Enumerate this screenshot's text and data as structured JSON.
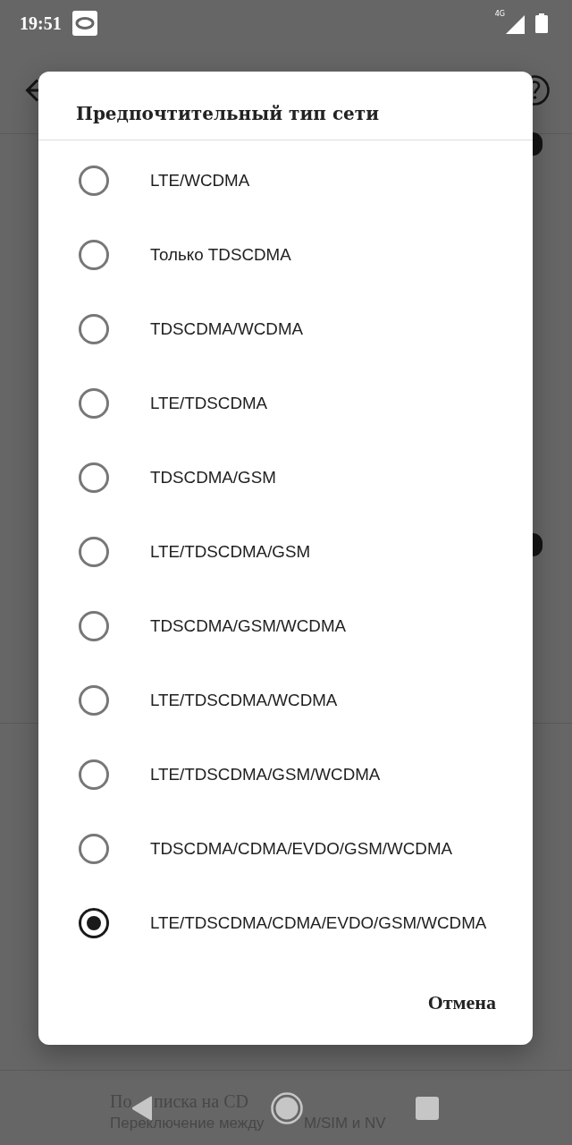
{
  "status_bar": {
    "time": "19:51",
    "network_type": "4G"
  },
  "background_list": [
    {
      "title_parts": [
        "По",
        "писка на CD"
      ],
      "subtitle_parts": [
        "Переключение между",
        "M/SIM и NV"
      ]
    }
  ],
  "dialog": {
    "title": "Предпочтительный тип сети",
    "options": [
      {
        "label": "LTE/WCDMA",
        "selected": false
      },
      {
        "label": "Только TDSCDMA",
        "selected": false
      },
      {
        "label": "TDSCDMA/WCDMA",
        "selected": false
      },
      {
        "label": "LTE/TDSCDMA",
        "selected": false
      },
      {
        "label": "TDSCDMA/GSM",
        "selected": false
      },
      {
        "label": "LTE/TDSCDMA/GSM",
        "selected": false
      },
      {
        "label": "TDSCDMA/GSM/WCDMA",
        "selected": false
      },
      {
        "label": "LTE/TDSCDMA/WCDMA",
        "selected": false
      },
      {
        "label": "LTE/TDSCDMA/GSM/WCDMA",
        "selected": false
      },
      {
        "label": "TDSCDMA/CDMA/EVDO/GSM/WCDMA",
        "selected": false
      },
      {
        "label": "LTE/TDSCDMA/CDMA/EVDO/GSM/WCDMA",
        "selected": true
      }
    ],
    "buttons": [
      "Отмена"
    ]
  }
}
